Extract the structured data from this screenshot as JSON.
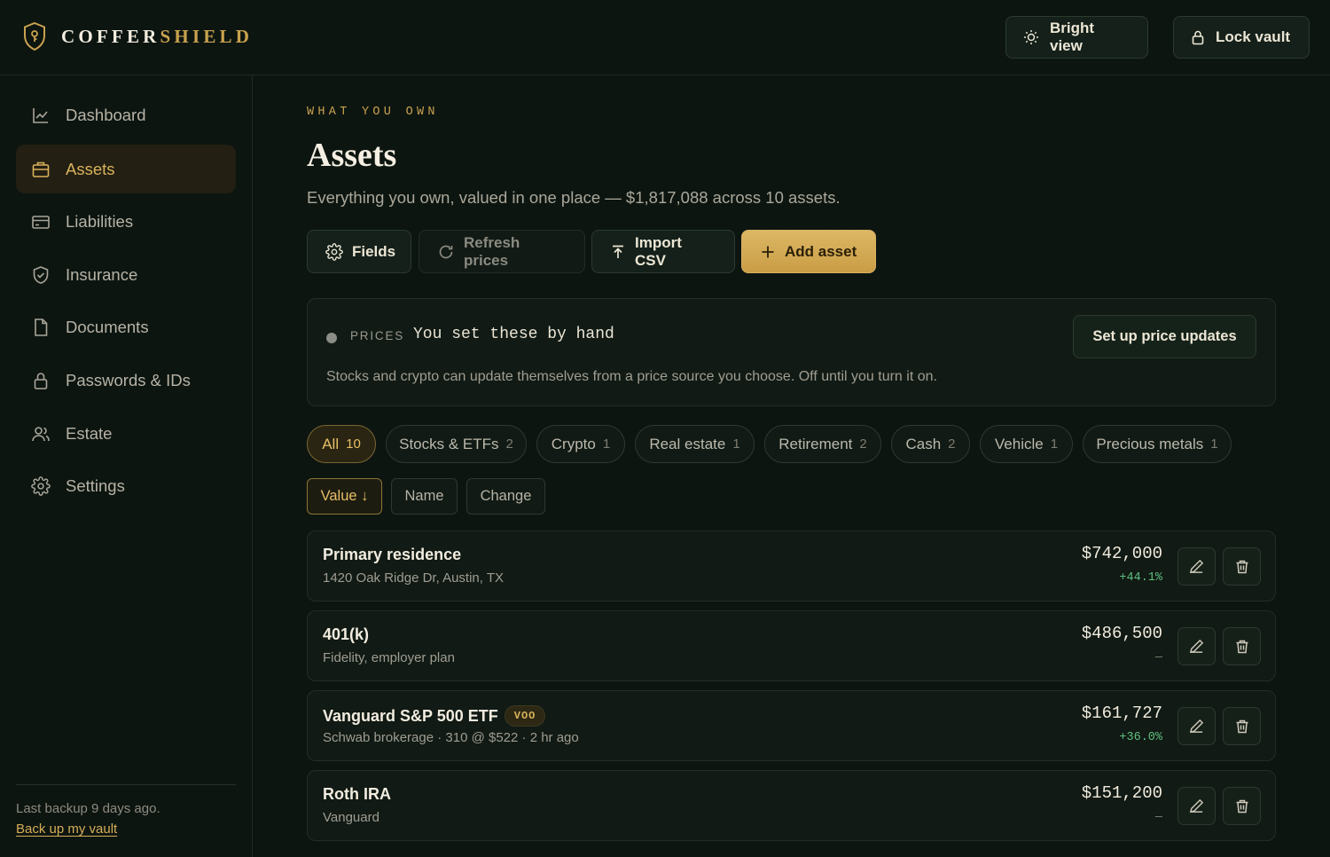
{
  "header": {
    "brand_part1": "COFFER",
    "brand_part2": "SHIELD",
    "bright_label": "Bright view",
    "lock_label": "Lock vault"
  },
  "sidebar": {
    "items": [
      {
        "label": "Dashboard",
        "icon": "chart-line-icon"
      },
      {
        "label": "Assets",
        "icon": "briefcase-icon",
        "active": true
      },
      {
        "label": "Liabilities",
        "icon": "credit-card-icon"
      },
      {
        "label": "Insurance",
        "icon": "shield-check-icon"
      },
      {
        "label": "Documents",
        "icon": "document-icon"
      },
      {
        "label": "Passwords & IDs",
        "icon": "lock-icon"
      },
      {
        "label": "Estate",
        "icon": "users-icon"
      },
      {
        "label": "Settings",
        "icon": "gear-icon"
      }
    ],
    "backup_note": "Last backup 9 days ago.",
    "backup_link": "Back up my vault"
  },
  "main": {
    "eyebrow": "WHAT YOU OWN",
    "title": "Assets",
    "subtitle": "Everything you own, valued in one place — $1,817,088 across 10 assets.",
    "toolbar": {
      "fields": "Fields",
      "refresh": "Refresh prices",
      "import": "Import CSV",
      "add": "Add asset"
    },
    "prices": {
      "label": "PRICES",
      "value": "You set these by hand",
      "description": "Stocks and crypto can update themselves from a price source you choose. Off until you turn it on.",
      "button": "Set up price updates"
    },
    "filters": [
      {
        "label": "All",
        "count": "10",
        "active": true
      },
      {
        "label": "Stocks & ETFs",
        "count": "2"
      },
      {
        "label": "Crypto",
        "count": "1"
      },
      {
        "label": "Real estate",
        "count": "1"
      },
      {
        "label": "Retirement",
        "count": "2"
      },
      {
        "label": "Cash",
        "count": "2"
      },
      {
        "label": "Vehicle",
        "count": "1"
      },
      {
        "label": "Precious metals",
        "count": "1"
      }
    ],
    "sorts": [
      {
        "label": "Value ↓",
        "active": true
      },
      {
        "label": "Name"
      },
      {
        "label": "Change"
      }
    ],
    "assets": [
      {
        "name": "Primary residence",
        "ticker": "",
        "sub": "1420 Oak Ridge Dr, Austin, TX",
        "value": "$742,000",
        "change": "+44.1%"
      },
      {
        "name": "401(k)",
        "ticker": "",
        "sub": "Fidelity, employer plan",
        "value": "$486,500",
        "change": "—"
      },
      {
        "name": "Vanguard S&P 500 ETF",
        "ticker": "VOO",
        "sub": "Schwab brokerage · 310 @ $522 · 2 hr ago",
        "value": "$161,727",
        "change": "+36.0%"
      },
      {
        "name": "Roth IRA",
        "ticker": "",
        "sub": "Vanguard",
        "value": "$151,200",
        "change": "—"
      }
    ]
  },
  "colors": {
    "background": "#0d1510",
    "accent": "#c9a24f",
    "positive": "#5fbf7f"
  }
}
